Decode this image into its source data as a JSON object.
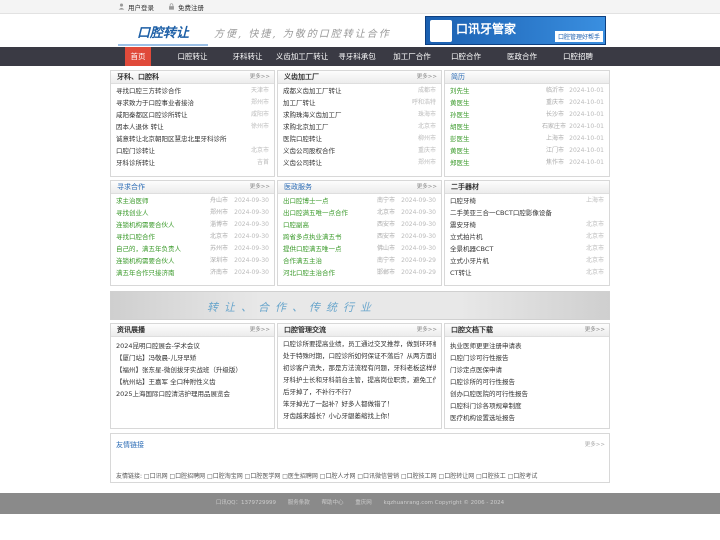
{
  "topbar": {
    "login": "用户登录",
    "register": "免费注册"
  },
  "header": {
    "logo": "口腔转让",
    "slogan": "方便, 快捷, 为敬的口腔转让合作",
    "banner": {
      "title": "口讯牙管家",
      "tag": "口腔管理好帮手"
    }
  },
  "nav": [
    "首页",
    "口腔转让",
    "牙科转让",
    "义齿加工厂转让",
    "寻牙科承包",
    "加工厂合作",
    "口腔合作",
    "医政合作",
    "口腔招聘"
  ],
  "more": "更多>>",
  "sections": {
    "s1": {
      "title": "牙科、口腔科",
      "rows": [
        {
          "t": "寻找口腔三方转诊合作",
          "c": "天津市"
        },
        {
          "t": "寻求致力于口腔事业者接洽",
          "c": "郑州市"
        },
        {
          "t": "咸阳秦都区口腔诊所转让",
          "c": "咸阳市"
        },
        {
          "t": "因本人退休 转让",
          "c": "徐州市"
        },
        {
          "t": "诚意转让北京朝阳区慧忠北里牙科诊所",
          "c": "北京市"
        },
        {
          "t": "口腔门诊转让",
          "c": "北京市"
        },
        {
          "t": "牙科诊所转让",
          "c": "吉首"
        }
      ]
    },
    "s2": {
      "title": "义齿加工厂",
      "rows": [
        {
          "t": "成都义齿加工厂转让",
          "c": "成都市"
        },
        {
          "t": "加工厂转让",
          "c": "呼和浩特"
        },
        {
          "t": "求购珠海义齿加工厂",
          "c": "珠海市"
        },
        {
          "t": "求购北京加工厂",
          "c": "北京市"
        },
        {
          "t": "医院口腔转让",
          "c": "柳州市"
        },
        {
          "t": "义齿公司股权合作",
          "c": "重庆市"
        },
        {
          "t": "义齿公司转让",
          "c": "郑州市"
        }
      ]
    },
    "s3": {
      "title": "简历",
      "rows": [
        {
          "t": "刘先生",
          "c": "临沂市",
          "d": "2024-10-01"
        },
        {
          "t": "黄医生",
          "c": "重庆市",
          "d": "2024-10-01"
        },
        {
          "t": "孙医生",
          "c": "长沙市",
          "d": "2024-10-01"
        },
        {
          "t": "胡医生",
          "c": "石家庄市",
          "d": "2024-10-01"
        },
        {
          "t": "彭医生",
          "c": "上海市",
          "d": "2024-10-01"
        },
        {
          "t": "黄医生",
          "c": "江门市",
          "d": "2024-10-01"
        },
        {
          "t": "郑医生",
          "c": "焦作市",
          "d": "2024-10-01"
        }
      ]
    },
    "s4": {
      "title": "寻求合作",
      "rows": [
        {
          "t": "求主治医师",
          "c": "舟山市",
          "d": "2024-09-30"
        },
        {
          "t": "寻找创业人",
          "c": "郑州市",
          "d": "2024-09-30"
        },
        {
          "t": "连锁机构需要合伙人",
          "c": "淄博市",
          "d": "2024-09-30"
        },
        {
          "t": "寻找口腔合作",
          "c": "北京市",
          "d": "2024-09-30"
        },
        {
          "t": "自己的，满五年负责人",
          "c": "苏州市",
          "d": "2024-09-30"
        },
        {
          "t": "连锁机构需要合伙人",
          "c": "深圳市",
          "d": "2024-09-30"
        },
        {
          "t": "满五年合作只接济南",
          "c": "济南市",
          "d": "2024-09-30"
        }
      ]
    },
    "s5": {
      "title": "医政服务",
      "rows": [
        {
          "t": "出口腔博士一点",
          "c": "南宁市",
          "d": "2024-09-30"
        },
        {
          "t": "出口腔满五唯一点合作",
          "c": "北京市",
          "d": "2024-09-30"
        },
        {
          "t": "口腔副高",
          "c": "西安市",
          "d": "2024-09-30"
        },
        {
          "t": "跨省多点执业满五书",
          "c": "西安市",
          "d": "2024-09-30"
        },
        {
          "t": "提供口腔满五唯一点",
          "c": "佛山市",
          "d": "2024-09-30"
        },
        {
          "t": "合作满五主治",
          "c": "南宁市",
          "d": "2024-09-29"
        },
        {
          "t": "河北口腔主治合作",
          "c": "邯郸市",
          "d": "2024-09-29"
        }
      ]
    },
    "s6": {
      "title": "二手器材",
      "rows": [
        {
          "t": "口腔牙椅",
          "c": "上海市"
        },
        {
          "t": "二手美亚三合一CBCT口腔影像设备",
          "c": "上海市"
        },
        {
          "t": "震安牙椅",
          "c": "北京市"
        },
        {
          "t": "立式拍片机",
          "c": "北京市"
        },
        {
          "t": "全景机器CBCT",
          "c": "北京市"
        },
        {
          "t": "立式小牙片机",
          "c": "北京市"
        },
        {
          "t": "CT转让",
          "c": "北京市"
        }
      ]
    },
    "s7": {
      "title": "资讯展播",
      "rows": [
        "2024昆明口腔展会-学术会议",
        "【厦门站】冯敬晨-儿牙早矫",
        "【福州】张东星-微创拔牙实战班（升级版）",
        "【杭州站】王嘉军 全口种附性义齿",
        "2025上海国际口腔清洁护理用品展览会"
      ]
    },
    "s8": {
      "title": "口腔管理交流",
      "rows": [
        "口腔诊所要提高业绩，员工通过交叉推荐，做到环环相扣",
        "处于特殊时期，口腔诊所如何保证不落后？从两方面出发",
        "初诊客户流失，那是方法流程有问题，牙科老板这样做",
        "牙科护士长和牙科前台主管，提高岗位职责，避免工作没",
        "后牙掉了，不补行不行？",
        "笨牙掉光了一起补？好多人都做错了！",
        "牙齿越来越长？小心牙龈萎缩找上你！"
      ]
    },
    "s9": {
      "title": "口腔文档下载",
      "rows": [
        "执业医师更更注册申请表",
        "口腔门诊可行性报告",
        "门诊定点医保申请",
        "口腔诊所的可行性报告",
        "创办口腔医院的可行性报告",
        "口腔科门诊各项规章制度",
        "医疗机构设置选址报告"
      ]
    }
  },
  "wide_banner": "转让、合作、传统行业",
  "links": {
    "title": "友情链接",
    "line": "友情链接:  □口讯网  □口腔招聘网  □口腔淘宝网  □口腔医学网  □医生招聘网  □口腔人才网  □口讯微信营销  □口腔技工网  □口腔转让网  □口腔技工  □口腔考试"
  },
  "footer": [
    "口讯QQ：1379729999",
    "服务条款",
    "帮助中心",
    "重庆网",
    "kqzhuanrang.com Copyright © 2006 - 2024"
  ]
}
